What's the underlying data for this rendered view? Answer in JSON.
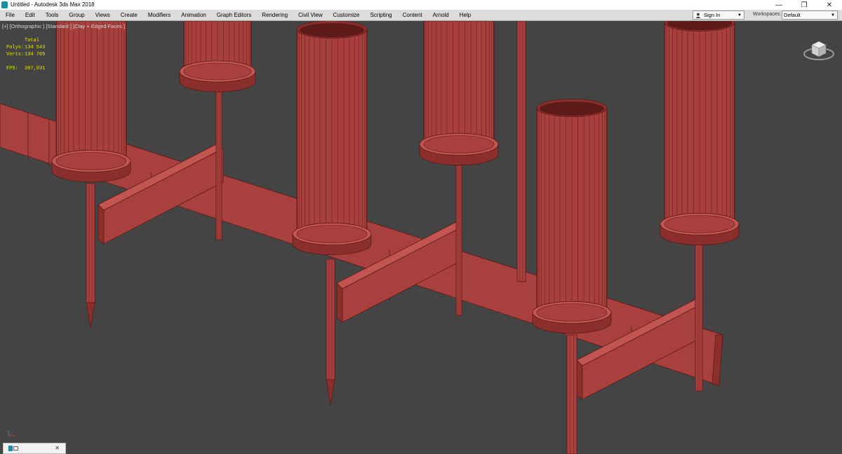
{
  "window": {
    "title": "Untitled - Autodesk 3ds Max 2018",
    "minimize_glyph": "—",
    "restore_glyph": "❐",
    "close_glyph": "✕"
  },
  "menu": [
    "File",
    "Edit",
    "Tools",
    "Group",
    "Views",
    "Create",
    "Modifiers",
    "Animation",
    "Graph Editors",
    "Rendering",
    "Civil View",
    "Customize",
    "Scripting",
    "Content",
    "Arnold",
    "Help"
  ],
  "signin": {
    "label": "Sign In"
  },
  "workspaces": {
    "label": "Workspaces:",
    "value": "Default"
  },
  "viewport": {
    "label": "[+] [Orthographic ] [Standard ] [Clay + Edged Faces ]",
    "stats": {
      "header": "Total",
      "polys_label": "Polys:",
      "polys_value": "134 543",
      "verts_label": "Verts:",
      "verts_value": "134 705",
      "fps_label": "FPS:",
      "fps_value": "307,031"
    },
    "clay_color": "#a8403d",
    "clay_dark": "#5c1a18",
    "clay_mid": "#8a2f2c",
    "clay_light": "#c25550",
    "background": "#444444",
    "stats_color": "#e6e600"
  },
  "taskbar": {
    "close_glyph": "✕"
  },
  "icons": [
    "app-icon",
    "user-icon",
    "viewcube-icon",
    "axis-tripod-icon",
    "viewport-icon",
    "close-icon"
  ]
}
